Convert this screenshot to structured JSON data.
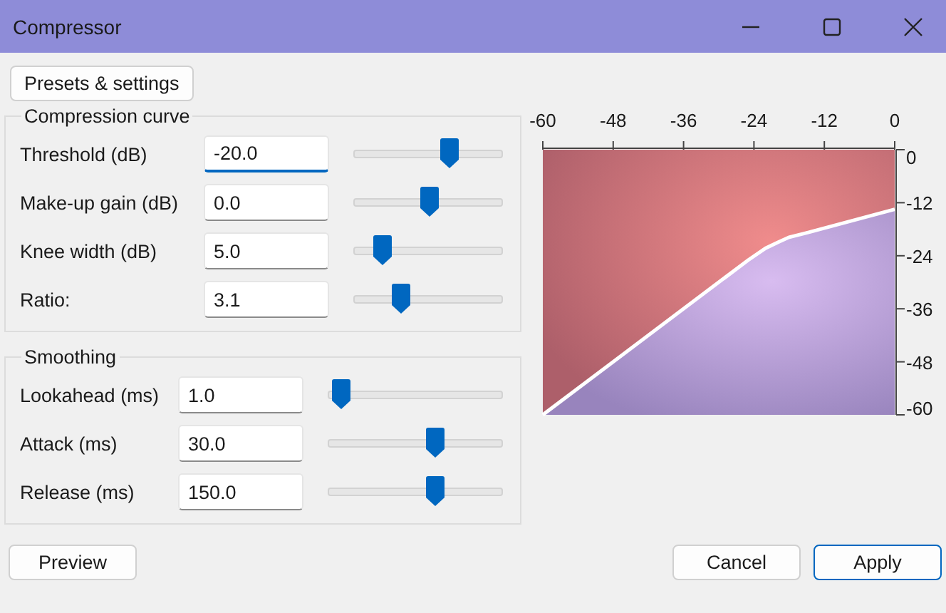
{
  "window": {
    "title": "Compressor"
  },
  "presets_button": "Presets & settings",
  "groups": [
    {
      "title": "Compression curve",
      "rows": [
        {
          "label": "Threshold (dB)",
          "value": "-20.0",
          "focused": true,
          "level": 0.64
        },
        {
          "label": "Make-up gain (dB)",
          "value": "0.0",
          "focused": false,
          "level": 0.5
        },
        {
          "label": "Knee width (dB)",
          "value": "5.0",
          "focused": false,
          "level": 0.19
        },
        {
          "label": "Ratio:",
          "value": "3.1",
          "focused": false,
          "level": 0.31
        }
      ]
    },
    {
      "title": "Smoothing",
      "rows": [
        {
          "label": "Lookahead (ms)",
          "value": "1.0",
          "focused": false,
          "level": 0.07
        },
        {
          "label": "Attack (ms)",
          "value": "30.0",
          "focused": false,
          "level": 0.61
        },
        {
          "label": "Release (ms)",
          "value": "150.0",
          "focused": false,
          "level": 0.61
        }
      ]
    }
  ],
  "chart_data": {
    "type": "line",
    "x": [
      -60,
      -25,
      -22,
      -20,
      -18,
      -15,
      0
    ],
    "series": [
      {
        "color": "#ffffff",
        "values": [
          -60,
          -25,
          -22.3,
          -21,
          -19.8,
          -18.8,
          -13.5
        ]
      }
    ],
    "xlim": [
      -60,
      0
    ],
    "ylim": [
      -60,
      0
    ],
    "xticks": [
      -60,
      -48,
      -36,
      -24,
      -12,
      0
    ],
    "yticks": [
      0,
      -12,
      -24,
      -36,
      -48,
      -60
    ]
  },
  "buttons": [
    {
      "label": "Preview",
      "default": false
    },
    {
      "label": "Cancel",
      "default": false
    },
    {
      "label": "Apply",
      "default": true
    }
  ]
}
